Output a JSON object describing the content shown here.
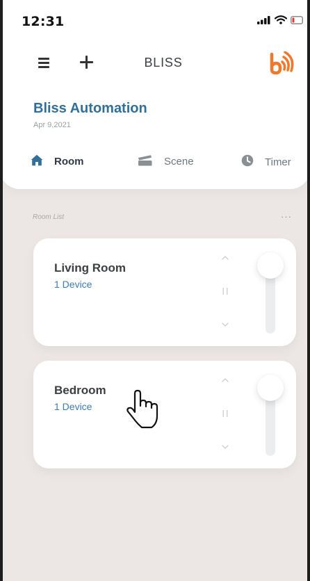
{
  "status_bar": {
    "time": "12:31",
    "icons": [
      "signal-icon",
      "wifi-icon",
      "battery-icon"
    ]
  },
  "header": {
    "title": "BLISS",
    "menu_icon": "menu-icon",
    "add_icon": "plus-icon",
    "logo_icon": "bliss-logo-icon",
    "logo_color": "#f0782d"
  },
  "home": {
    "name": "Bliss Automation",
    "date": "Apr 9,2021",
    "accent_color": "#2f6f98"
  },
  "tabs": [
    {
      "label": "Room",
      "icon": "home-icon",
      "active": true
    },
    {
      "label": "Scene",
      "icon": "scene-icon",
      "active": false
    },
    {
      "label": "Timer",
      "icon": "clock-icon",
      "active": false
    }
  ],
  "room_list": {
    "label": "Room List",
    "more": "···",
    "rooms": [
      {
        "name": "Living Room",
        "devices": "1 Device",
        "level": 1.0
      },
      {
        "name": "Bedroom",
        "devices": "1 Device",
        "level": 1.0
      }
    ]
  },
  "controls": {
    "up_icon": "chevron-up-icon",
    "pause_icon": "pause-icon",
    "down_icon": "chevron-down-icon"
  }
}
